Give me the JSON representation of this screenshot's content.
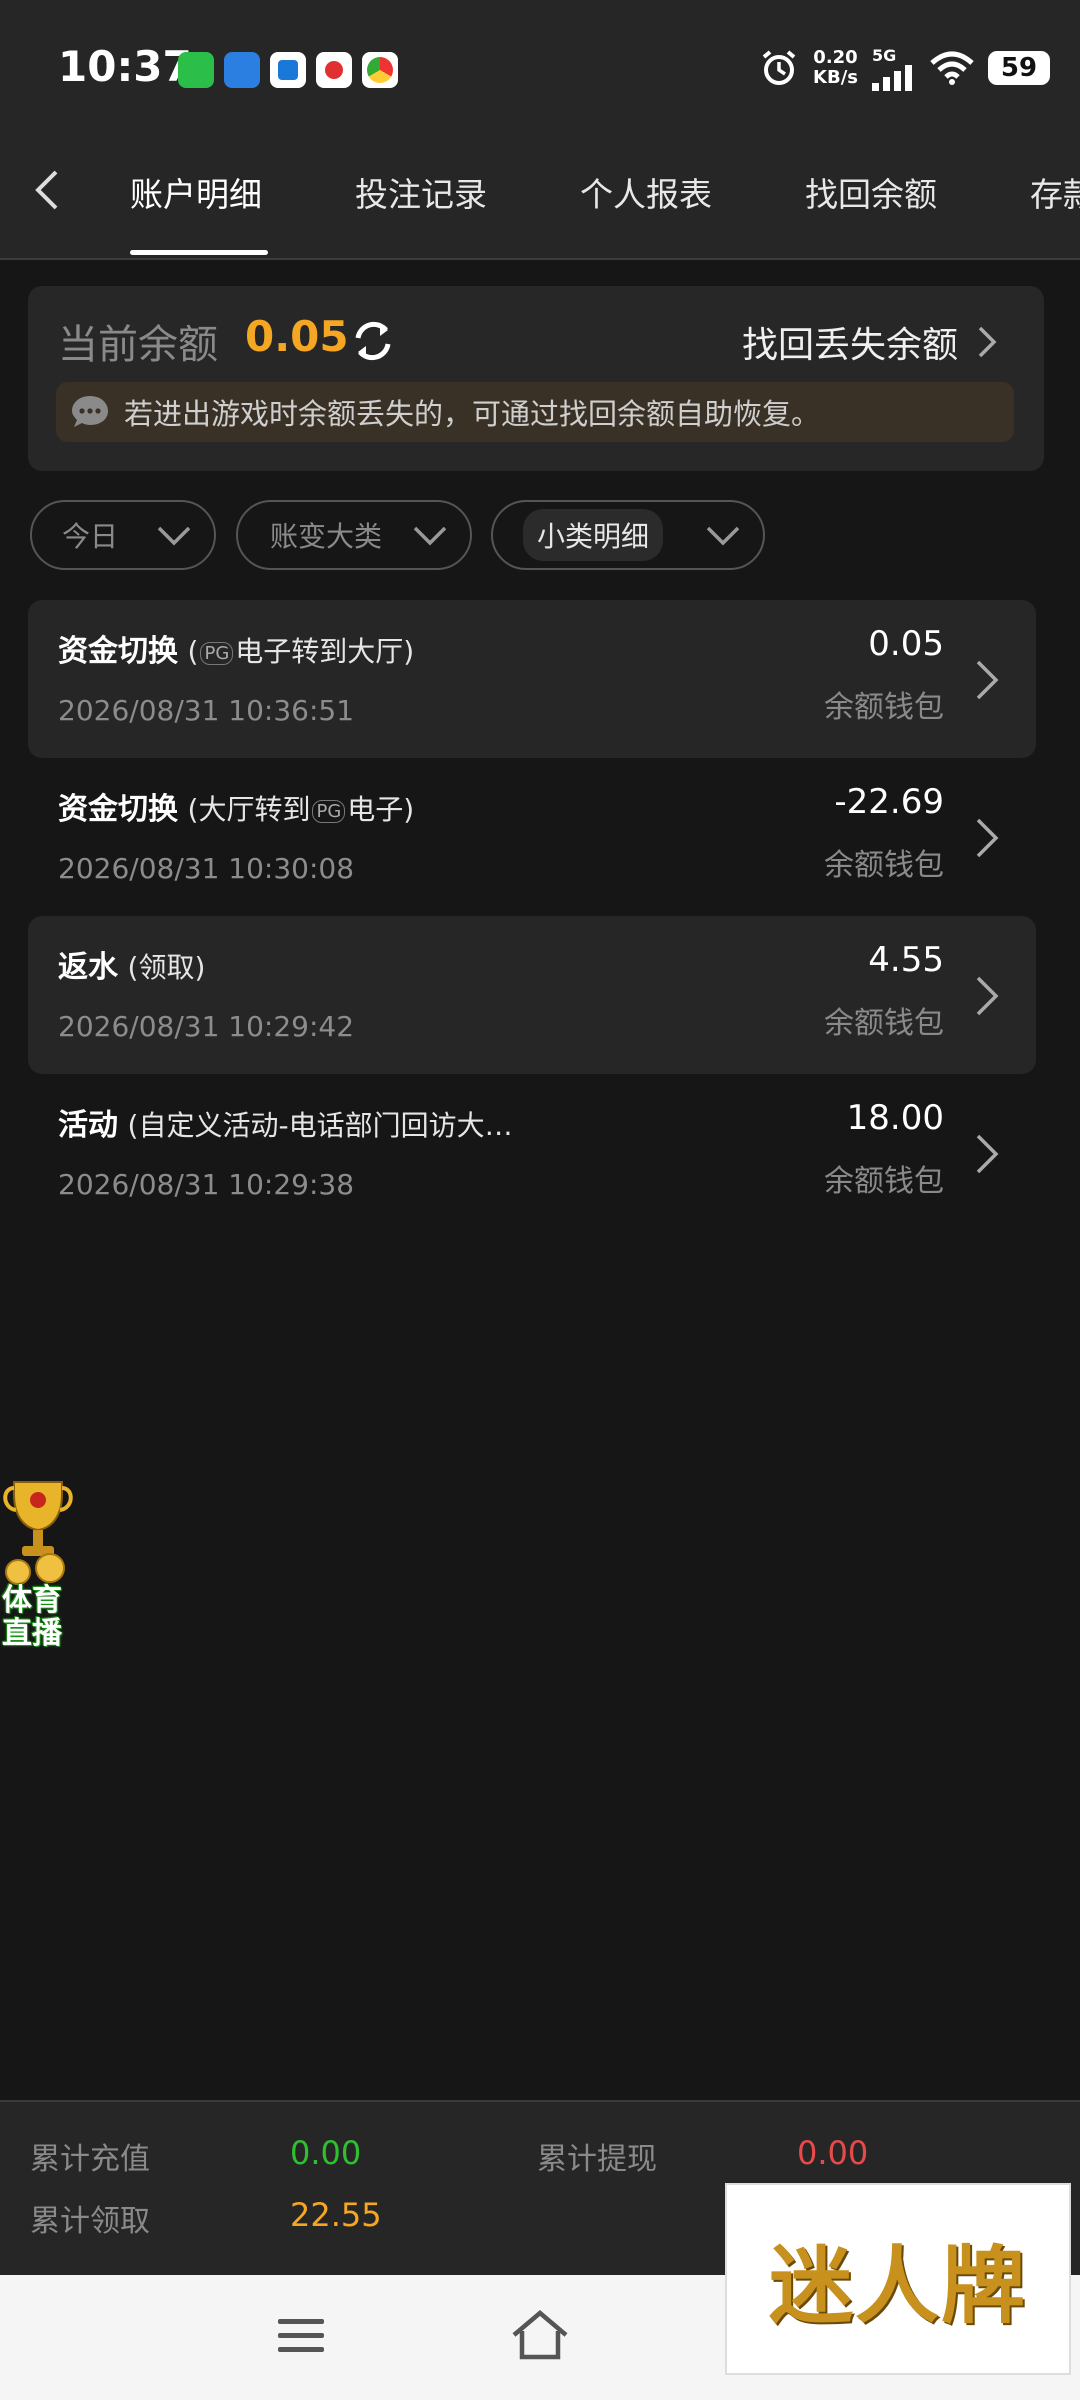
{
  "status": {
    "time": "10:37",
    "net_speed_value": "0.20",
    "net_speed_unit": "KB/s",
    "network": "5G",
    "battery": "59"
  },
  "tabs": [
    "账户明细",
    "投注记录",
    "个人报表",
    "找回余额",
    "存款"
  ],
  "balance": {
    "label": "当前余额",
    "value": "0.05",
    "recover_label": "找回丢失余额",
    "notice": "若进出游戏时余额丢失的，可通过找回余额自助恢复。"
  },
  "filters": [
    "今日",
    "账变大类",
    "小类明细"
  ],
  "records": [
    {
      "type": "资金切换",
      "sub_before": "(",
      "sub_after": "电子转到大厅)",
      "date": "2026/08/31 10:36:51",
      "amount": "0.05",
      "wallet": "余额钱包"
    },
    {
      "type": "资金切换",
      "sub_before": "(大厅转到",
      "sub_after": "电子)",
      "date": "2026/08/31 10:30:08",
      "amount": "-22.69",
      "wallet": "余额钱包"
    },
    {
      "type": "返水",
      "sub_before": "(领取)",
      "sub_after": "",
      "date": "2026/08/31 10:29:42",
      "amount": "4.55",
      "wallet": "余额钱包"
    },
    {
      "type": "活动",
      "sub_before": "(自定义活动-电话部门回访大…",
      "sub_after": "",
      "date": "2026/08/31 10:29:38",
      "amount": "18.00",
      "wallet": "余额钱包"
    }
  ],
  "pg_badge": "PG",
  "sports_widget": {
    "line1": "体育",
    "line2": "直播"
  },
  "totals": {
    "recharge_label": "累计充值",
    "recharge_value": "0.00",
    "withdraw_label": "累计提现",
    "withdraw_value": "0.00",
    "claim_label": "累计领取",
    "claim_value": "22.55"
  },
  "logo_text": "迷人牌",
  "colors": {
    "accent": "#f5a623",
    "green": "#2ec02e",
    "red": "#e84a4a",
    "background": "#161616"
  }
}
